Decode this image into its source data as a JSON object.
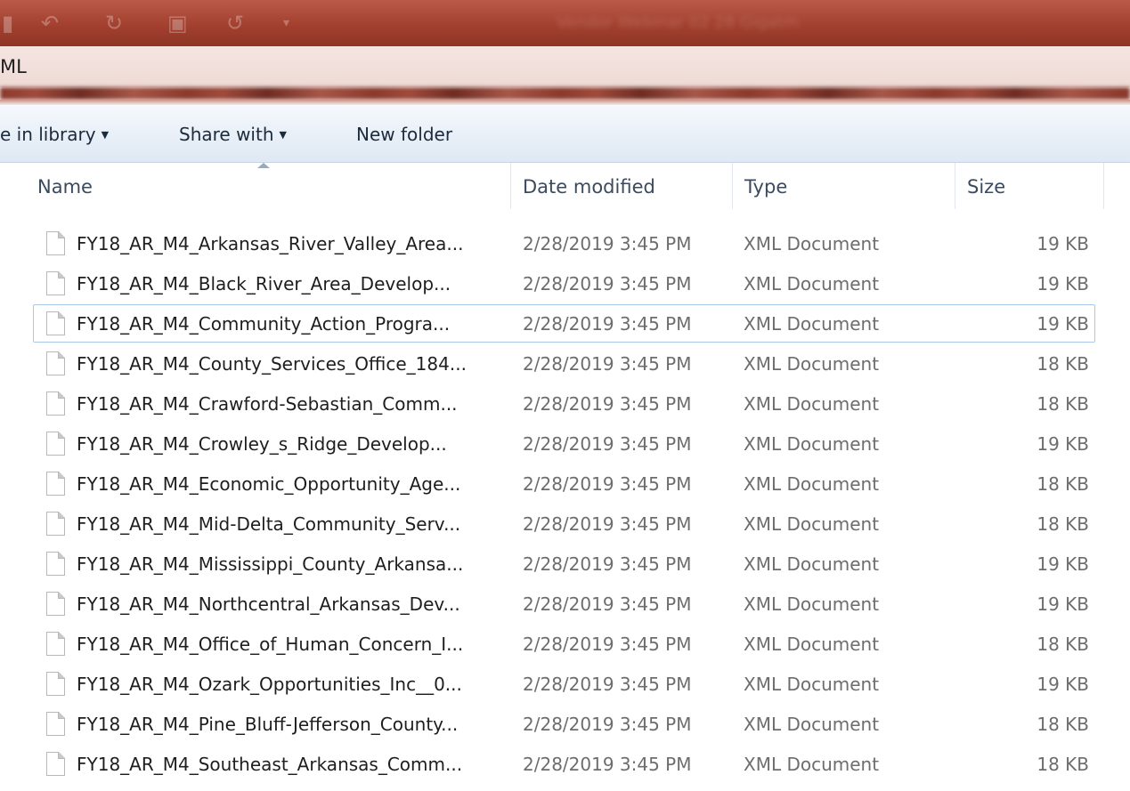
{
  "window": {
    "title": "Vendor Webinar 02 28 Gigatm",
    "ribbon_label": "ML"
  },
  "toolbar": {
    "include_in_library": "e in library",
    "share_with": "Share with",
    "new_folder": "New folder"
  },
  "columns": {
    "name": "Name",
    "date_modified": "Date modified",
    "type": "Type",
    "size": "Size"
  },
  "sort": {
    "column": "name",
    "direction": "ascending"
  },
  "files": [
    {
      "name": "FY18_AR_M4_Arkansas_River_Valley_Area...",
      "date": "2/28/2019 3:45 PM",
      "type": "XML Document",
      "size": "19 KB"
    },
    {
      "name": "FY18_AR_M4_Black_River_Area_Develop...",
      "date": "2/28/2019 3:45 PM",
      "type": "XML Document",
      "size": "19 KB"
    },
    {
      "name": "FY18_AR_M4_Community_Action_Progra...",
      "date": "2/28/2019 3:45 PM",
      "type": "XML Document",
      "size": "19 KB",
      "focused": true
    },
    {
      "name": "FY18_AR_M4_County_Services_Office_184...",
      "date": "2/28/2019 3:45 PM",
      "type": "XML Document",
      "size": "18 KB"
    },
    {
      "name": "FY18_AR_M4_Crawford-Sebastian_Comm...",
      "date": "2/28/2019 3:45 PM",
      "type": "XML Document",
      "size": "18 KB"
    },
    {
      "name": "FY18_AR_M4_Crowley_s_Ridge_Develop...",
      "date": "2/28/2019 3:45 PM",
      "type": "XML Document",
      "size": "19 KB"
    },
    {
      "name": "FY18_AR_M4_Economic_Opportunity_Age...",
      "date": "2/28/2019 3:45 PM",
      "type": "XML Document",
      "size": "18 KB"
    },
    {
      "name": "FY18_AR_M4_Mid-Delta_Community_Serv...",
      "date": "2/28/2019 3:45 PM",
      "type": "XML Document",
      "size": "18 KB"
    },
    {
      "name": "FY18_AR_M4_Mississippi_County_Arkansa...",
      "date": "2/28/2019 3:45 PM",
      "type": "XML Document",
      "size": "19 KB"
    },
    {
      "name": "FY18_AR_M4_Northcentral_Arkansas_Dev...",
      "date": "2/28/2019 3:45 PM",
      "type": "XML Document",
      "size": "19 KB"
    },
    {
      "name": "FY18_AR_M4_Office_of_Human_Concern_I...",
      "date": "2/28/2019 3:45 PM",
      "type": "XML Document",
      "size": "18 KB"
    },
    {
      "name": "FY18_AR_M4_Ozark_Opportunities_Inc__0...",
      "date": "2/28/2019 3:45 PM",
      "type": "XML Document",
      "size": "19 KB"
    },
    {
      "name": "FY18_AR_M4_Pine_Bluff-Jefferson_County...",
      "date": "2/28/2019 3:45 PM",
      "type": "XML Document",
      "size": "18 KB"
    },
    {
      "name": "FY18_AR_M4_Southeast_Arkansas_Comm...",
      "date": "2/28/2019 3:45 PM",
      "type": "XML Document",
      "size": "18 KB"
    }
  ],
  "icons": {
    "file": "file-icon",
    "undo": "undo-icon",
    "dropdown": "caret-down-icon"
  },
  "colors": {
    "titlebar": "#a3402f",
    "selection_border": "#a9c8ea",
    "secondary_text": "#6d6d6d"
  }
}
